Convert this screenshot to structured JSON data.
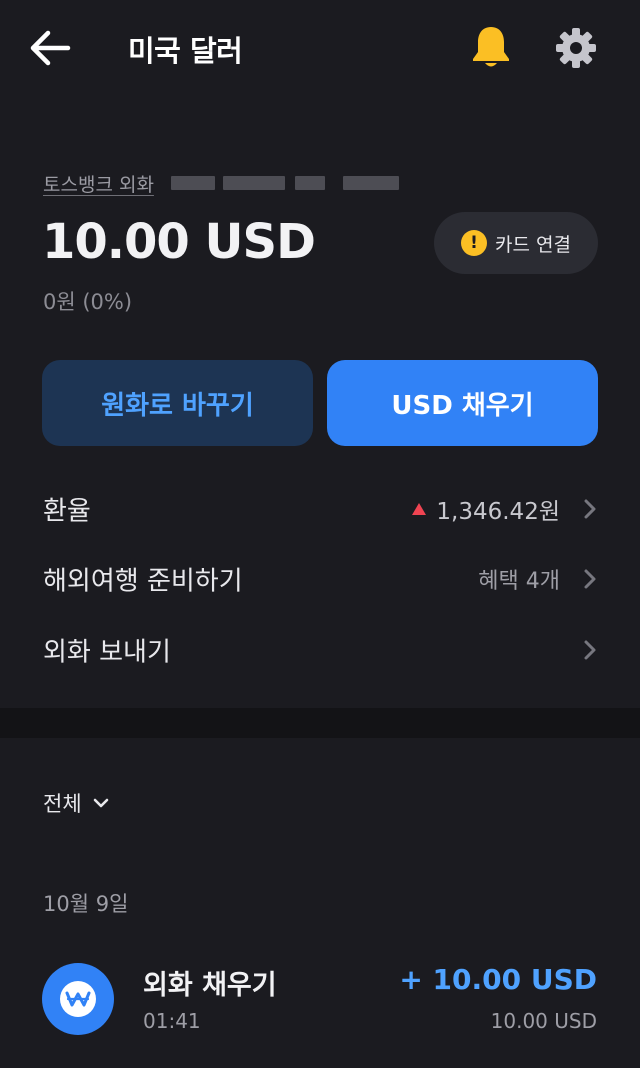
{
  "header": {
    "title": "미국 달러"
  },
  "account": {
    "name": "토스뱅크 외화",
    "balance": "10.00 USD",
    "krw_value": "0원 (0%)",
    "card_link_label": "카드 연결"
  },
  "actions": {
    "convert_label": "원화로 바꾸기",
    "fill_label": "USD 채우기"
  },
  "rows": [
    {
      "label": "환율",
      "value": "1,346.42원",
      "trend": "up"
    },
    {
      "label": "해외여행 준비하기",
      "value": "혜택 4개"
    },
    {
      "label": "외화 보내기",
      "value": ""
    }
  ],
  "filter": {
    "label": "전체"
  },
  "transactions": {
    "date": "10월 9일",
    "items": [
      {
        "title": "외화 채우기",
        "time": "01:41",
        "amount": "+ 10.00 USD",
        "sub": "10.00 USD"
      }
    ]
  },
  "colors": {
    "background": "#1b1b20",
    "accent_blue": "#3182f6",
    "light_blue": "#4fa2ff",
    "bell_yellow": "#fbbf24",
    "up_red": "#f04452"
  },
  "icons": [
    "back-arrow-icon",
    "bell-icon",
    "gear-icon",
    "warning-icon",
    "up-triangle-icon",
    "chevron-right-icon",
    "chevron-down-icon",
    "won-coin-icon"
  ]
}
